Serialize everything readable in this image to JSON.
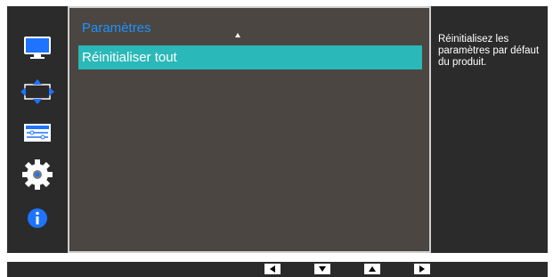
{
  "sidebar": {
    "items": [
      {
        "icon": "monitor-icon"
      },
      {
        "icon": "screen-adjust-icon"
      },
      {
        "icon": "picture-settings-icon"
      },
      {
        "icon": "gear-icon"
      },
      {
        "icon": "info-icon"
      }
    ]
  },
  "panel": {
    "title": "Paramètres",
    "selected_item": "Réinitialiser tout"
  },
  "help": {
    "text": "Réinitialisez les paramètres par défaut du produit."
  },
  "bottom_bar": {
    "buttons": [
      "left-arrow-button",
      "down-arrow-button",
      "up-arrow-button",
      "right-arrow-button"
    ]
  },
  "colors": {
    "title": "#1e90ff",
    "highlight": "#2bb8b8",
    "panel_bg": "#4b4641",
    "frame_bg": "#2b2b2b"
  }
}
